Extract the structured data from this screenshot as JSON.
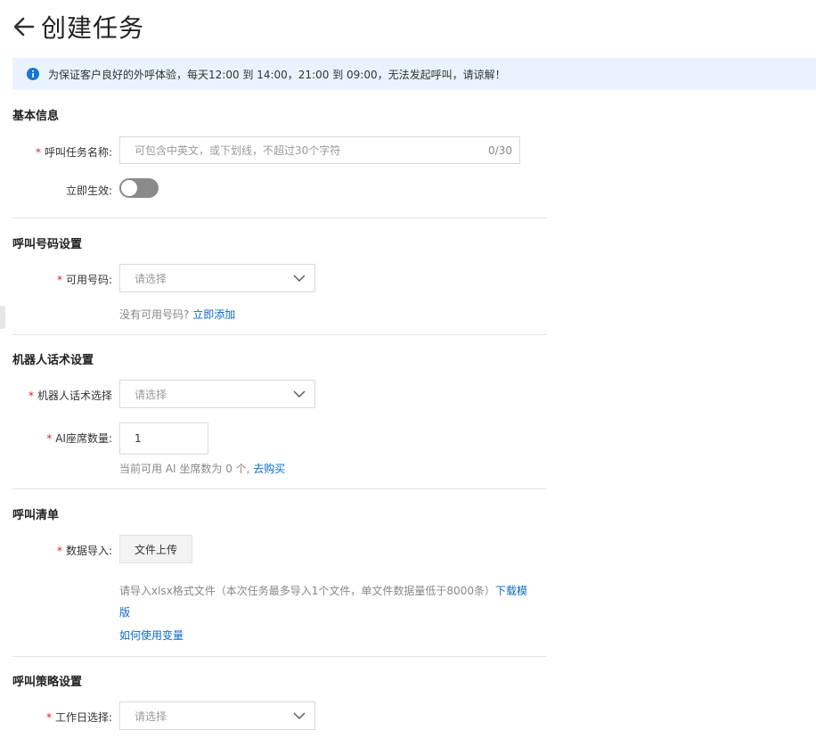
{
  "header": {
    "title": "创建任务"
  },
  "notice": {
    "text": "为保证客户良好的外呼体验，每天12:00 到 14:00，21:00 到 09:00，无法发起呼叫，请谅解！"
  },
  "basic": {
    "section_title": "基本信息",
    "task_name_label": "呼叫任务名称:",
    "task_name_placeholder": "可包含中英文，或下划线，不超过30个字符",
    "task_name_counter": "0/30",
    "effective_label": "立即生效:",
    "effective_on": false
  },
  "number": {
    "section_title": "呼叫号码设置",
    "available_label": "可用号码:",
    "available_placeholder": "请选择",
    "hint_text": "没有可用号码?",
    "hint_link": "立即添加"
  },
  "robot": {
    "section_title": "机器人话术设置",
    "script_label": "机器人话术选择",
    "script_placeholder": "请选择",
    "seats_label": "AI座席数量:",
    "seats_value": "1",
    "seats_hint": "当前可用 AI 坐席数为 0 个,",
    "seats_link": "去购买"
  },
  "list": {
    "section_title": "呼叫清单",
    "import_label": "数据导入:",
    "upload_button": "文件上传",
    "hint_text": "请导入xlsx格式文件（本次任务最多导入1个文件，单文件数据量低于8000条）",
    "template_link_a": "下载模",
    "template_link_b": "版",
    "variable_link": "如何使用变量"
  },
  "strategy": {
    "section_title": "呼叫策略设置",
    "workday_label": "工作日选择:",
    "workday_placeholder": "请选择"
  },
  "colors": {
    "accent": "#0b6bc6",
    "required": "#e02020",
    "notice_bg": "#e8f3fd",
    "info_icon": "#1677d2"
  }
}
